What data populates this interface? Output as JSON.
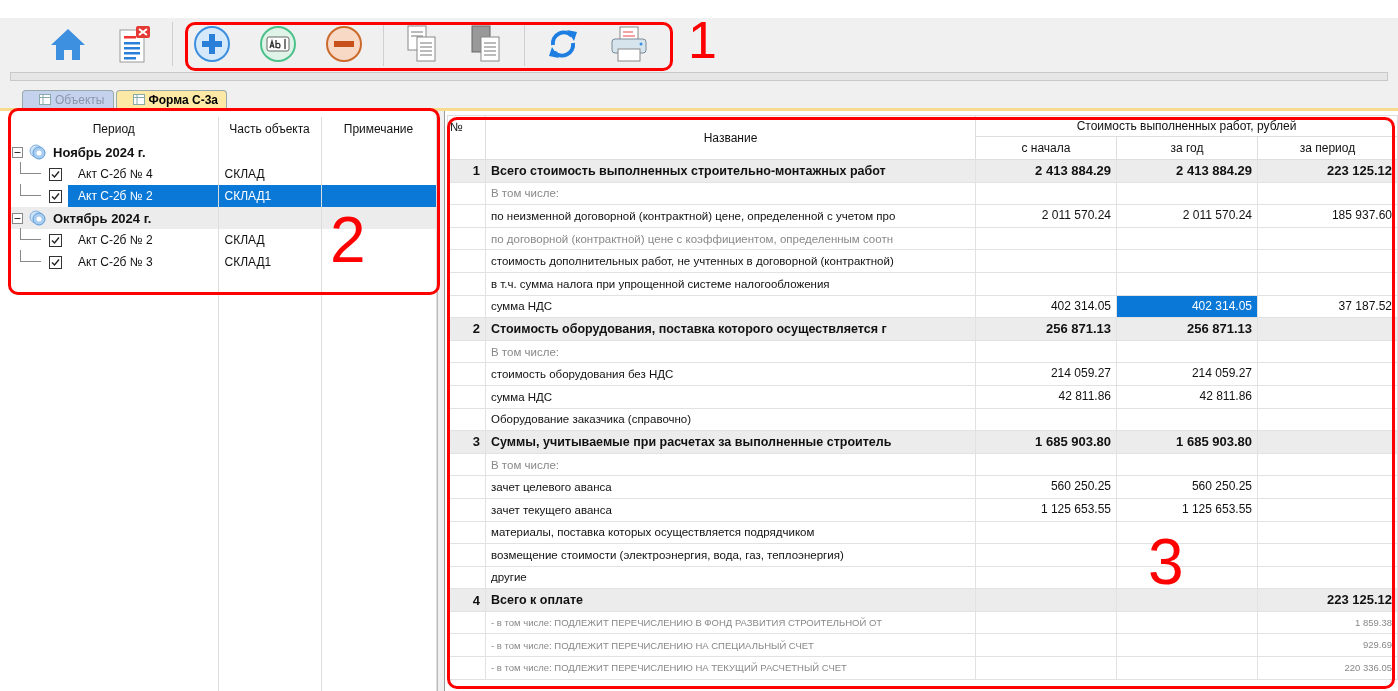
{
  "toolbar": [
    [
      {
        "kind": "home"
      },
      {
        "kind": "doc-delete"
      }
    ],
    [
      {
        "kind": "add"
      },
      {
        "kind": "edit"
      },
      {
        "kind": "remove"
      }
    ],
    [
      {
        "kind": "copy"
      },
      {
        "kind": "paste"
      }
    ],
    [
      {
        "kind": "refresh"
      },
      {
        "kind": "print"
      }
    ]
  ],
  "tabs": [
    {
      "label": "Объекты",
      "selected": false
    },
    {
      "label": "Форма С-3а",
      "selected": true
    }
  ],
  "tree": {
    "columns": [
      "Период",
      "Часть объекта",
      "Примечание"
    ],
    "groups": [
      {
        "label": "Ноябрь 2024 г.",
        "expanded": true,
        "children": [
          {
            "label": "Акт С-2б № 4",
            "part": "СКЛАД",
            "checked": true,
            "selected": false
          },
          {
            "label": "Акт С-2б № 2",
            "part": "СКЛАД1",
            "checked": true,
            "selected": true
          }
        ]
      },
      {
        "label": "Октябрь 2024 г.",
        "expanded": true,
        "children": [
          {
            "label": "Акт С-2б № 2",
            "part": "СКЛАД",
            "checked": true,
            "selected": false
          },
          {
            "label": "Акт С-2б № 3",
            "part": "СКЛАД1",
            "checked": true,
            "selected": false
          }
        ]
      }
    ]
  },
  "table": {
    "columns": {
      "number": "№",
      "name": "Название",
      "group": "Стоимость выполненных работ, рублей",
      "values": [
        "с начала",
        "за год",
        "за период"
      ]
    },
    "rows": [
      {
        "kind": "section",
        "number": "1",
        "name": "Всего стоимость выполненных строительно-монтажных работ",
        "cells": [
          {
            "text": "2 413 884.29",
            "selected": false
          },
          {
            "text": "2 413 884.29",
            "selected": false
          },
          {
            "text": "223 125.12",
            "selected": false
          }
        ]
      },
      {
        "kind": "sub",
        "name": "В том числе:",
        "cells": [
          {
            "selected": false
          },
          {
            "selected": false
          },
          {
            "selected": false
          }
        ]
      },
      {
        "kind": "item",
        "name": "по неизменной договорной (контрактной) цене, определенной с учетом про",
        "cells": [
          {
            "text": "2 011 570.24",
            "selected": false
          },
          {
            "text": "2 011 570.24",
            "selected": false
          },
          {
            "text": "185 937.60",
            "selected": false
          }
        ]
      },
      {
        "kind": "sub",
        "name": "по договорной (контрактной) цене с коэффициентом, определенным соотн",
        "cells": [
          {
            "selected": false
          },
          {
            "selected": false
          },
          {
            "selected": false
          }
        ]
      },
      {
        "kind": "item",
        "name": "стоимость дополнительных работ, не учтенных в договорной (контрактной)",
        "cells": [
          {
            "selected": false
          },
          {
            "selected": false
          },
          {
            "selected": false
          }
        ]
      },
      {
        "kind": "item",
        "name": "в т.ч. сумма налога при упрощенной системе налогообложения",
        "cells": [
          {
            "selected": false
          },
          {
            "selected": false
          },
          {
            "selected": false
          }
        ]
      },
      {
        "kind": "item",
        "name": "сумма НДС",
        "cells": [
          {
            "text": "402 314.05",
            "selected": false
          },
          {
            "text": "402 314.05",
            "selected": true
          },
          {
            "text": "37 187.52",
            "selected": false
          }
        ]
      },
      {
        "kind": "section",
        "number": "2",
        "name": "Стоимость оборудования, поставка которого осуществляется г",
        "cells": [
          {
            "text": "256 871.13",
            "selected": false
          },
          {
            "text": "256 871.13",
            "selected": false
          },
          {
            "selected": false
          }
        ]
      },
      {
        "kind": "sub",
        "name": "В том числе:",
        "cells": [
          {
            "selected": false
          },
          {
            "selected": false
          },
          {
            "selected": false
          }
        ]
      },
      {
        "kind": "item",
        "name": "стоимость оборудования без НДС",
        "cells": [
          {
            "text": "214 059.27",
            "selected": false
          },
          {
            "text": "214 059.27",
            "selected": false
          },
          {
            "selected": false
          }
        ]
      },
      {
        "kind": "item",
        "name": "сумма НДС",
        "cells": [
          {
            "text": "42 811.86",
            "selected": false
          },
          {
            "text": "42 811.86",
            "selected": false
          },
          {
            "selected": false
          }
        ]
      },
      {
        "kind": "item",
        "name": "Оборудование заказчика (справочно)",
        "cells": [
          {
            "selected": false
          },
          {
            "selected": false
          },
          {
            "selected": false
          }
        ]
      },
      {
        "kind": "section",
        "number": "3",
        "name": "Суммы, учитываемые при расчетах за выполненные строитель",
        "cells": [
          {
            "text": "1 685 903.80",
            "selected": false
          },
          {
            "text": "1 685 903.80",
            "selected": false
          },
          {
            "selected": false
          }
        ]
      },
      {
        "kind": "sub",
        "name": "В том числе:",
        "cells": [
          {
            "selected": false
          },
          {
            "selected": false
          },
          {
            "selected": false
          }
        ]
      },
      {
        "kind": "item",
        "name": "зачет целевого аванса",
        "cells": [
          {
            "text": "560 250.25",
            "selected": false
          },
          {
            "text": "560 250.25",
            "selected": false
          },
          {
            "selected": false
          }
        ]
      },
      {
        "kind": "item",
        "name": "зачет текущего аванса",
        "cells": [
          {
            "text": "1 125 653.55",
            "selected": false
          },
          {
            "text": "1 125 653.55",
            "selected": false
          },
          {
            "selected": false
          }
        ]
      },
      {
        "kind": "item",
        "name": "материалы, поставка которых осуществляется подрядчиком",
        "cells": [
          {
            "selected": false
          },
          {
            "selected": false
          },
          {
            "selected": false
          }
        ]
      },
      {
        "kind": "item",
        "name": "возмещение стоимости (электроэнергия, вода, газ, теплоэнергия)",
        "cells": [
          {
            "selected": false
          },
          {
            "selected": false
          },
          {
            "selected": false
          }
        ]
      },
      {
        "kind": "item",
        "name": "другие",
        "cells": [
          {
            "selected": false
          },
          {
            "selected": false
          },
          {
            "selected": false
          }
        ]
      },
      {
        "kind": "section",
        "number": "4",
        "name": "Всего к оплате",
        "cells": [
          {
            "selected": false
          },
          {
            "selected": false
          },
          {
            "text": "223 125.12",
            "selected": false
          }
        ]
      },
      {
        "kind": "note",
        "name": "- в том числе: ПОДЛЕЖИТ ПЕРЕЧИСЛЕНИЮ В ФОНД РАЗВИТИЯ СТРОИТЕЛЬНОЙ ОТ",
        "cells": [
          {
            "selected": false
          },
          {
            "selected": false
          },
          {
            "text": "1 859.38",
            "selected": false
          }
        ]
      },
      {
        "kind": "note",
        "name": "- в том числе: ПОДЛЕЖИТ ПЕРЕЧИСЛЕНИЮ НА СПЕЦИАЛЬНЫЙ СЧЕТ",
        "cells": [
          {
            "selected": false
          },
          {
            "selected": false
          },
          {
            "text": "929.69",
            "selected": false
          }
        ]
      },
      {
        "kind": "note",
        "name": "- в том числе: ПОДЛЕЖИТ ПЕРЕЧИСЛЕНИЮ НА ТЕКУЩИЙ РАСЧЕТНЫЙ СЧЕТ",
        "cells": [
          {
            "selected": false
          },
          {
            "selected": false
          },
          {
            "text": "220 336.05",
            "selected": false
          }
        ]
      }
    ]
  },
  "annotations": [
    {
      "label": "1"
    },
    {
      "label": "2"
    },
    {
      "label": "3"
    }
  ]
}
